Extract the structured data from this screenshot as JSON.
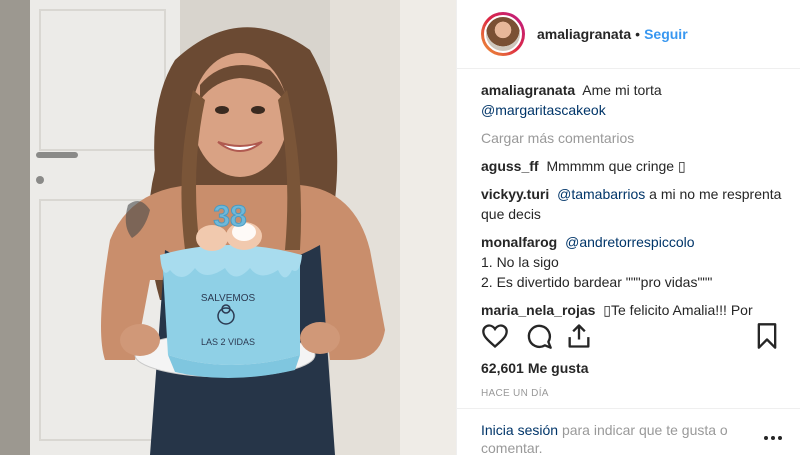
{
  "header": {
    "username": "amaliagranata",
    "separator": "•",
    "follow_label": "Seguir"
  },
  "caption": {
    "username": "amaliagranata",
    "text": "Ame mi torta",
    "mention": "@margaritascakeok"
  },
  "load_more_label": "Cargar más comentarios",
  "comments": [
    {
      "username": "aguss_ff",
      "text": "Mmmmm que cringe ▯"
    },
    {
      "username": "vickyy.turi",
      "mention": "@tamabarrios",
      "text": "a mi no me resprenta que decis"
    },
    {
      "username": "monalfarog",
      "mention": "@andretorrespiccolo",
      "lines": [
        "1. No la sigo",
        "2. Es divertido bardear \"\"\"pro vidas\"\"\""
      ]
    },
    {
      "username": "maria_nela_rojas",
      "text": "▯Te felicito Amalia!!! Por"
    }
  ],
  "actions": {
    "like_icon": "heart-icon",
    "comment_icon": "comment-icon",
    "share_icon": "share-icon",
    "save_icon": "bookmark-icon"
  },
  "likes": {
    "count": "62,601",
    "label": "Me gusta"
  },
  "timestamp": "HACE UN DÍA",
  "footer": {
    "login_link": "Inicia sesión",
    "login_text": "para indicar que te gusta o comentar."
  },
  "photo": {
    "cake_text_top": "SALVEMOS",
    "cake_text_bottom": "LAS 2 VIDAS",
    "candles": "38"
  },
  "colors": {
    "link_blue": "#3897f0",
    "mention_navy": "#003569",
    "muted_gray": "#999999",
    "cake_blue": "#8fd0e6"
  }
}
